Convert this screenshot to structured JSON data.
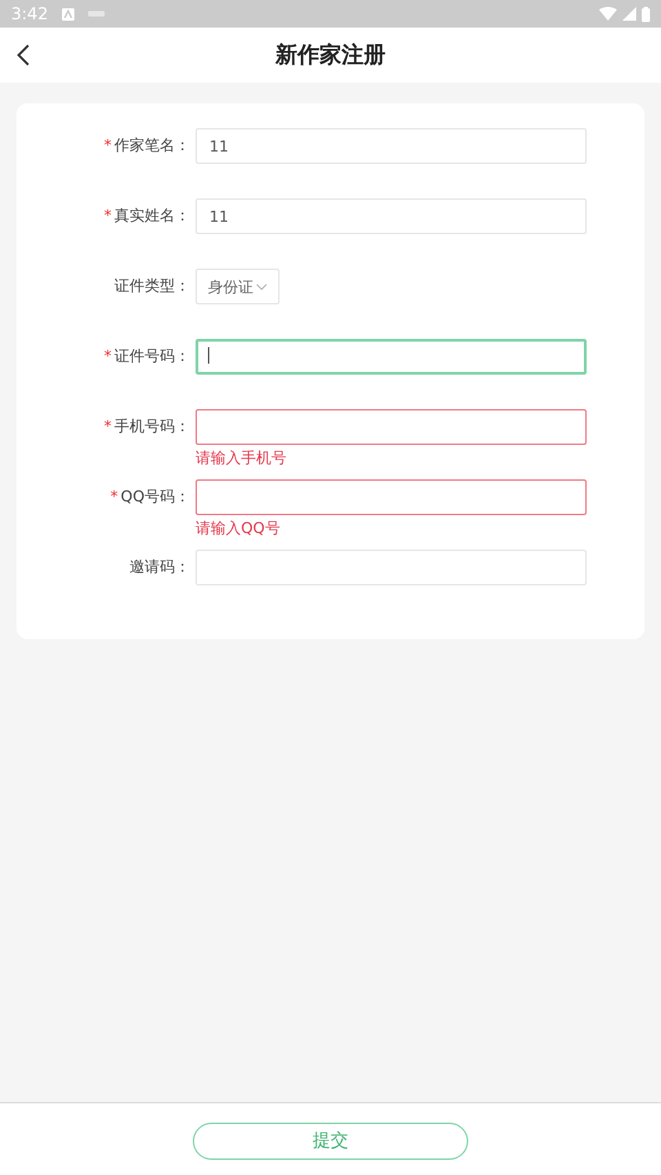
{
  "status_bar": {
    "time": "3:42"
  },
  "header": {
    "title": "新作家注册"
  },
  "form": {
    "fields": [
      {
        "mark": "*",
        "label": "作家笔名：",
        "kind": "input",
        "value": "11",
        "focused": false,
        "invalid": false
      },
      {
        "mark": "*",
        "label": "真实姓名：",
        "kind": "input",
        "value": "11",
        "focused": false,
        "invalid": false
      },
      {
        "label": "证件类型：",
        "kind": "select",
        "value": "身份证"
      },
      {
        "mark": "*",
        "label": "证件号码：",
        "kind": "input",
        "focused": true,
        "invalid": false
      },
      {
        "mark": "*",
        "label": "手机号码：",
        "kind": "input",
        "focused": false,
        "invalid": true,
        "error": "请输入手机号"
      },
      {
        "mark": "*",
        "label": "QQ号码：",
        "kind": "input",
        "focused": false,
        "invalid": true,
        "error": "请输入QQ号"
      },
      {
        "label": "邀请码：",
        "kind": "input",
        "focused": false,
        "invalid": false
      }
    ]
  },
  "footer": {
    "button": "提交"
  }
}
